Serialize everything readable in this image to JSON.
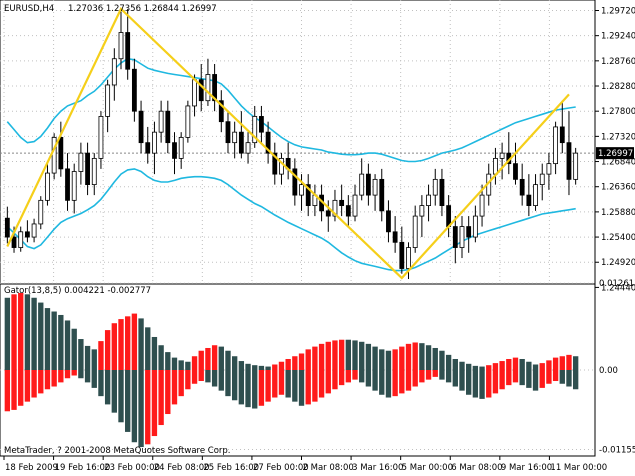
{
  "window": {
    "symbol_label": "EURUSD,H4",
    "ohlc_label": "1.27036 1.27356 1.26844 1.26997",
    "current_price_label": "1.26997"
  },
  "indicator": {
    "label": "Gator(13,8,5) 0.004221 -0.002777"
  },
  "watermark": "MetaTrader, ? 2001-2008 MetaQuotes Software Corp.",
  "colors": {
    "bull": "#ffffff",
    "bear": "#000000",
    "envelope": "#1fb8e0",
    "zigzag": "#f5cf1a",
    "gator_up": "#ff1a1a",
    "gator_down": "#2f4f4f",
    "grid": "#c0c0c0"
  },
  "chart_data": [
    {
      "type": "candlestick",
      "title": "EURUSD,H4",
      "ylim": [
        1.242,
        1.2992
      ],
      "price_ticks": [
        "1.29720",
        "1.29240",
        "1.28760",
        "1.28280",
        "1.27800",
        "1.27320",
        "1.26840",
        "1.26360",
        "1.25880",
        "1.25400",
        "1.24920",
        "1.24440"
      ],
      "x_labels": [
        "18 Feb 2009",
        "19 Feb 16:00",
        "23 Feb 00:00",
        "24 Feb 08:00",
        "25 Feb 16:00",
        "27 Feb 00:00",
        "2 Mar 08:00",
        "3 Mar 16:00",
        "5 Mar 00:00",
        "6 Mar 08:00",
        "9 Mar 16:00",
        "11 Mar 00:00"
      ],
      "candles": [
        [
          1.2576,
          1.2598,
          1.2528,
          1.254
        ],
        [
          1.254,
          1.256,
          1.251,
          1.252
        ],
        [
          1.252,
          1.256,
          1.2512,
          1.255
        ],
        [
          1.255,
          1.2572,
          1.253,
          1.254
        ],
        [
          1.254,
          1.2575,
          1.253,
          1.2565
        ],
        [
          1.2565,
          1.2618,
          1.2555,
          1.261
        ],
        [
          1.261,
          1.268,
          1.26,
          1.2662
        ],
        [
          1.2662,
          1.2738,
          1.265,
          1.273
        ],
        [
          1.273,
          1.276,
          1.2655,
          1.267
        ],
        [
          1.267,
          1.27,
          1.259,
          1.261
        ],
        [
          1.261,
          1.268,
          1.2585,
          1.2665
        ],
        [
          1.2665,
          1.272,
          1.264,
          1.27
        ],
        [
          1.27,
          1.272,
          1.262,
          1.264
        ],
        [
          1.264,
          1.27,
          1.262,
          1.269
        ],
        [
          1.269,
          1.278,
          1.267,
          1.277
        ],
        [
          1.277,
          1.284,
          1.274,
          1.283
        ],
        [
          1.283,
          1.29,
          1.28,
          1.288
        ],
        [
          1.288,
          1.297,
          1.286,
          1.293
        ],
        [
          1.293,
          1.2975,
          1.284,
          1.286
        ],
        [
          1.286,
          1.288,
          1.276,
          1.278
        ],
        [
          1.278,
          1.28,
          1.27,
          1.272
        ],
        [
          1.272,
          1.275,
          1.268,
          1.27
        ],
        [
          1.27,
          1.276,
          1.266,
          1.274
        ],
        [
          1.274,
          1.28,
          1.272,
          1.278
        ],
        [
          1.278,
          1.28,
          1.27,
          1.272
        ],
        [
          1.272,
          1.274,
          1.266,
          1.269
        ],
        [
          1.269,
          1.274,
          1.267,
          1.273
        ],
        [
          1.273,
          1.28,
          1.272,
          1.279
        ],
        [
          1.279,
          1.285,
          1.277,
          1.284
        ],
        [
          1.284,
          1.287,
          1.278,
          1.28
        ],
        [
          1.28,
          1.288,
          1.279,
          1.285
        ],
        [
          1.285,
          1.287,
          1.278,
          1.28
        ],
        [
          1.28,
          1.282,
          1.274,
          1.276
        ],
        [
          1.276,
          1.278,
          1.27,
          1.272
        ],
        [
          1.272,
          1.276,
          1.269,
          1.274
        ],
        [
          1.274,
          1.278,
          1.269,
          1.27
        ],
        [
          1.27,
          1.274,
          1.268,
          1.272
        ],
        [
          1.272,
          1.279,
          1.271,
          1.277
        ],
        [
          1.277,
          1.279,
          1.272,
          1.274
        ],
        [
          1.274,
          1.276,
          1.268,
          1.27
        ],
        [
          1.27,
          1.272,
          1.264,
          1.266
        ],
        [
          1.266,
          1.27,
          1.264,
          1.269
        ],
        [
          1.269,
          1.272,
          1.265,
          1.267
        ],
        [
          1.267,
          1.269,
          1.26,
          1.262
        ],
        [
          1.262,
          1.266,
          1.259,
          1.264
        ],
        [
          1.264,
          1.266,
          1.258,
          1.26
        ],
        [
          1.26,
          1.264,
          1.258,
          1.262
        ],
        [
          1.262,
          1.264,
          1.257,
          1.259
        ],
        [
          1.259,
          1.261,
          1.255,
          1.258
        ],
        [
          1.258,
          1.263,
          1.257,
          1.261
        ],
        [
          1.261,
          1.264,
          1.258,
          1.26
        ],
        [
          1.26,
          1.262,
          1.256,
          1.258
        ],
        [
          1.258,
          1.264,
          1.257,
          1.262
        ],
        [
          1.262,
          1.269,
          1.261,
          1.266
        ],
        [
          1.266,
          1.268,
          1.26,
          1.262
        ],
        [
          1.262,
          1.266,
          1.259,
          1.265
        ],
        [
          1.265,
          1.267,
          1.257,
          1.259
        ],
        [
          1.259,
          1.261,
          1.253,
          1.255
        ],
        [
          1.255,
          1.258,
          1.251,
          1.253
        ],
        [
          1.253,
          1.256,
          1.247,
          1.248
        ],
        [
          1.248,
          1.253,
          1.246,
          1.252
        ],
        [
          1.252,
          1.26,
          1.251,
          1.258
        ],
        [
          1.258,
          1.262,
          1.254,
          1.26
        ],
        [
          1.26,
          1.264,
          1.257,
          1.262
        ],
        [
          1.262,
          1.267,
          1.26,
          1.265
        ],
        [
          1.265,
          1.267,
          1.258,
          1.26
        ],
        [
          1.26,
          1.262,
          1.254,
          1.256
        ],
        [
          1.256,
          1.258,
          1.249,
          1.252
        ],
        [
          1.252,
          1.258,
          1.25,
          1.256
        ],
        [
          1.256,
          1.258,
          1.251,
          1.254
        ],
        [
          1.254,
          1.26,
          1.253,
          1.258
        ],
        [
          1.258,
          1.264,
          1.256,
          1.262
        ],
        [
          1.262,
          1.268,
          1.26,
          1.266
        ],
        [
          1.266,
          1.271,
          1.264,
          1.269
        ],
        [
          1.269,
          1.272,
          1.265,
          1.27
        ],
        [
          1.27,
          1.274,
          1.266,
          1.268
        ],
        [
          1.268,
          1.272,
          1.264,
          1.265
        ],
        [
          1.265,
          1.268,
          1.26,
          1.262
        ],
        [
          1.262,
          1.266,
          1.258,
          1.26
        ],
        [
          1.26,
          1.266,
          1.259,
          1.264
        ],
        [
          1.264,
          1.268,
          1.261,
          1.266
        ],
        [
          1.266,
          1.27,
          1.263,
          1.268
        ],
        [
          1.268,
          1.276,
          1.266,
          1.275
        ],
        [
          1.275,
          1.28,
          1.27,
          1.272
        ],
        [
          1.272,
          1.278,
          1.262,
          1.265
        ],
        [
          1.265,
          1.271,
          1.264,
          1.27
        ]
      ],
      "band_upper": [
        1.276,
        1.2745,
        1.273,
        1.272,
        1.2722,
        1.2732,
        1.2748,
        1.2766,
        1.278,
        1.279,
        1.2795,
        1.28,
        1.281,
        1.2818,
        1.283,
        1.2845,
        1.286,
        1.2872,
        1.288,
        1.2878,
        1.287,
        1.2862,
        1.2858,
        1.2855,
        1.2852,
        1.285,
        1.2848,
        1.2846,
        1.2844,
        1.2842,
        1.284,
        1.2838,
        1.2832,
        1.282,
        1.2805,
        1.279,
        1.2778,
        1.2768,
        1.276,
        1.275,
        1.274,
        1.273,
        1.2722,
        1.2716,
        1.2712,
        1.271,
        1.2708,
        1.2706,
        1.2702,
        1.27,
        1.2698,
        1.2697,
        1.2697,
        1.2698,
        1.27,
        1.27,
        1.2698,
        1.2694,
        1.269,
        1.2686,
        1.2684,
        1.2684,
        1.2686,
        1.269,
        1.2695,
        1.27,
        1.2703,
        1.2706,
        1.271,
        1.2716,
        1.2722,
        1.2728,
        1.2734,
        1.274,
        1.2746,
        1.2752,
        1.2758,
        1.2762,
        1.2766,
        1.277,
        1.2774,
        1.2778,
        1.2782,
        1.2784,
        1.2786,
        1.2788
      ],
      "band_lower": [
        1.256,
        1.2548,
        1.2535,
        1.2522,
        1.2518,
        1.2525,
        1.254,
        1.2555,
        1.2568,
        1.2575,
        1.258,
        1.2585,
        1.2592,
        1.26,
        1.2612,
        1.2628,
        1.2645,
        1.266,
        1.2668,
        1.267,
        1.2665,
        1.2655,
        1.2648,
        1.2645,
        1.2645,
        1.2648,
        1.2652,
        1.2654,
        1.2655,
        1.2655,
        1.2654,
        1.2652,
        1.2648,
        1.264,
        1.263,
        1.262,
        1.2612,
        1.2604,
        1.2598,
        1.259,
        1.2582,
        1.2575,
        1.2568,
        1.2562,
        1.2556,
        1.255,
        1.2544,
        1.2538,
        1.253,
        1.252,
        1.251,
        1.2502,
        1.2495,
        1.249,
        1.2487,
        1.2484,
        1.2481,
        1.2478,
        1.2476,
        1.2476,
        1.2478,
        1.2482,
        1.2488,
        1.2494,
        1.25,
        1.2508,
        1.2516,
        1.2524,
        1.2532,
        1.2538,
        1.2544,
        1.2548,
        1.2552,
        1.2556,
        1.256,
        1.2564,
        1.2568,
        1.2572,
        1.2576,
        1.258,
        1.2584,
        1.2586,
        1.2588,
        1.259,
        1.2592,
        1.2594
      ],
      "zigzag": [
        [
          0,
          1.2522
        ],
        [
          17,
          1.2975
        ],
        [
          59,
          1.2462
        ],
        [
          84,
          1.2812
        ]
      ]
    },
    {
      "type": "bar",
      "title": "Gator(13,8,5) 0.004221 -0.002777",
      "ylim": [
        -0.0125,
        0.0125
      ],
      "ticks": [
        "0.012613",
        "0.00",
        "-0.01155"
      ],
      "upper": [
        0.0105,
        0.011,
        0.0112,
        0.011,
        0.0105,
        0.0098,
        0.009,
        0.0085,
        0.008,
        0.0072,
        0.006,
        0.0045,
        0.0035,
        0.003,
        0.0042,
        0.0058,
        0.0068,
        0.0074,
        0.0078,
        0.0082,
        0.0075,
        0.0062,
        0.0048,
        0.0036,
        0.0026,
        0.0018,
        0.0014,
        0.0012,
        0.002,
        0.0028,
        0.0032,
        0.0036,
        0.0034,
        0.0028,
        0.002,
        0.0013,
        0.0009,
        0.0007,
        0.0006,
        0.0005,
        0.0008,
        0.0012,
        0.0016,
        0.002,
        0.0024,
        0.003,
        0.0034,
        0.0038,
        0.0041,
        0.0043,
        0.0044,
        0.0044,
        0.0043,
        0.0041,
        0.0038,
        0.0034,
        0.003,
        0.0028,
        0.003,
        0.0034,
        0.0038,
        0.004,
        0.0039,
        0.0036,
        0.0032,
        0.0028,
        0.0022,
        0.0016,
        0.0012,
        0.0009,
        0.0006,
        0.0005,
        0.0007,
        0.001,
        0.0013,
        0.0016,
        0.0018,
        0.0016,
        0.0012,
        0.0008,
        0.001,
        0.0014,
        0.0018,
        0.002,
        0.0022,
        0.002
      ],
      "upper_up": [
        false,
        true,
        true,
        false,
        false,
        false,
        false,
        false,
        false,
        false,
        false,
        false,
        false,
        false,
        true,
        true,
        true,
        true,
        true,
        true,
        false,
        false,
        false,
        false,
        false,
        false,
        false,
        false,
        true,
        true,
        true,
        true,
        false,
        false,
        false,
        false,
        false,
        false,
        false,
        false,
        true,
        true,
        true,
        true,
        true,
        true,
        true,
        true,
        true,
        true,
        true,
        false,
        false,
        false,
        false,
        false,
        false,
        false,
        true,
        true,
        true,
        true,
        false,
        false,
        false,
        false,
        false,
        false,
        false,
        false,
        false,
        false,
        true,
        true,
        true,
        true,
        true,
        false,
        false,
        false,
        true,
        true,
        true,
        true,
        true,
        false
      ],
      "lower": [
        0.006,
        0.0058,
        0.0052,
        0.0046,
        0.004,
        0.0034,
        0.0028,
        0.0024,
        0.0018,
        0.0012,
        0.0008,
        0.0012,
        0.0018,
        0.0026,
        0.0038,
        0.005,
        0.0062,
        0.0076,
        0.009,
        0.0105,
        0.0112,
        0.0108,
        0.0096,
        0.008,
        0.0064,
        0.005,
        0.0038,
        0.0028,
        0.002,
        0.0016,
        0.0018,
        0.0024,
        0.003,
        0.0038,
        0.0044,
        0.005,
        0.0054,
        0.0056,
        0.0052,
        0.0046,
        0.004,
        0.0036,
        0.004,
        0.0046,
        0.0052,
        0.005,
        0.0046,
        0.004,
        0.0034,
        0.0028,
        0.0022,
        0.0018,
        0.0014,
        0.0018,
        0.0024,
        0.003,
        0.0036,
        0.004,
        0.0038,
        0.0034,
        0.003,
        0.0024,
        0.0018,
        0.0014,
        0.001,
        0.0014,
        0.0018,
        0.0024,
        0.003,
        0.0036,
        0.004,
        0.0042,
        0.004,
        0.0034,
        0.0028,
        0.0022,
        0.0018,
        0.0022,
        0.0026,
        0.003,
        0.0026,
        0.002,
        0.0016,
        0.002,
        0.0024,
        0.0028
      ],
      "lower_up": [
        true,
        true,
        true,
        true,
        true,
        true,
        true,
        true,
        true,
        true,
        true,
        false,
        false,
        false,
        false,
        false,
        false,
        false,
        false,
        false,
        false,
        true,
        true,
        true,
        true,
        true,
        true,
        true,
        true,
        true,
        false,
        false,
        false,
        false,
        false,
        false,
        false,
        false,
        true,
        true,
        true,
        true,
        false,
        false,
        false,
        true,
        true,
        true,
        true,
        true,
        true,
        true,
        true,
        false,
        false,
        false,
        false,
        false,
        true,
        true,
        true,
        true,
        true,
        true,
        true,
        false,
        false,
        false,
        false,
        false,
        false,
        false,
        true,
        true,
        true,
        true,
        true,
        false,
        false,
        false,
        true,
        true,
        true,
        false,
        false,
        false
      ]
    }
  ]
}
